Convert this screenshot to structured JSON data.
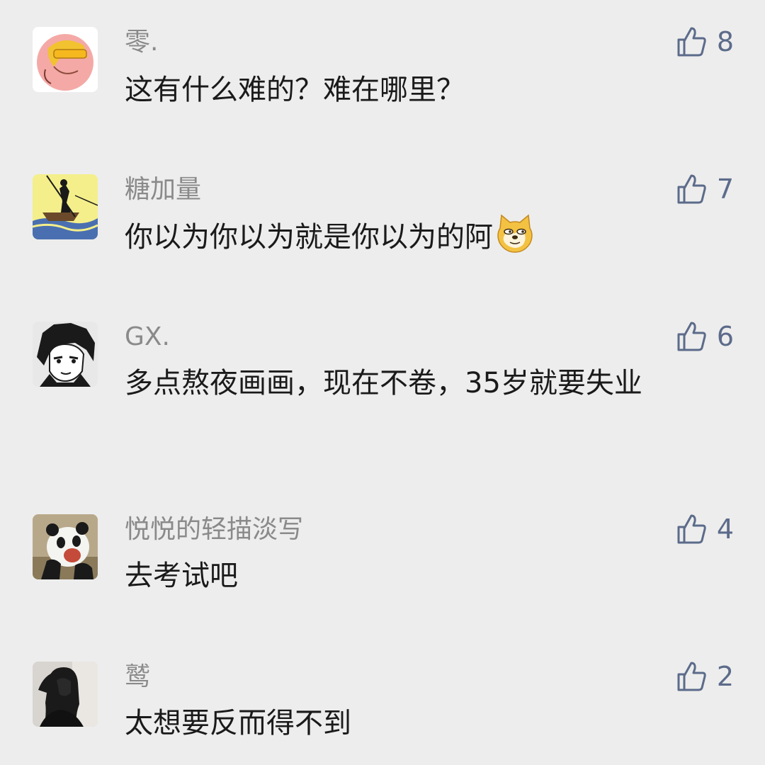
{
  "comments": [
    {
      "username": "零.",
      "text": "这有什么难的？难在哪里？",
      "likes": "8",
      "avatar_icon": "cartoon-face-avatar"
    },
    {
      "username": "糖加量",
      "text": "你以为你以为就是你以为的阿",
      "likes": "7",
      "avatar_icon": "boat-fisherman-avatar",
      "emoji": "doge-emoji"
    },
    {
      "username": "GX.",
      "text": "多点熬夜画画，现在不卷，35岁就要失业",
      "likes": "6",
      "avatar_icon": "manga-boy-avatar"
    },
    {
      "username": "悦悦的轻描淡写",
      "text": "去考试吧",
      "likes": "4",
      "avatar_icon": "panda-avatar"
    },
    {
      "username": "鹫",
      "text": "太想要反而得不到",
      "likes": "2",
      "avatar_icon": "girl-photo-avatar"
    }
  ],
  "colors": {
    "background": "#ededed",
    "username": "#8a8a8a",
    "text": "#1a1a1a",
    "like": "#5c6b8a"
  }
}
